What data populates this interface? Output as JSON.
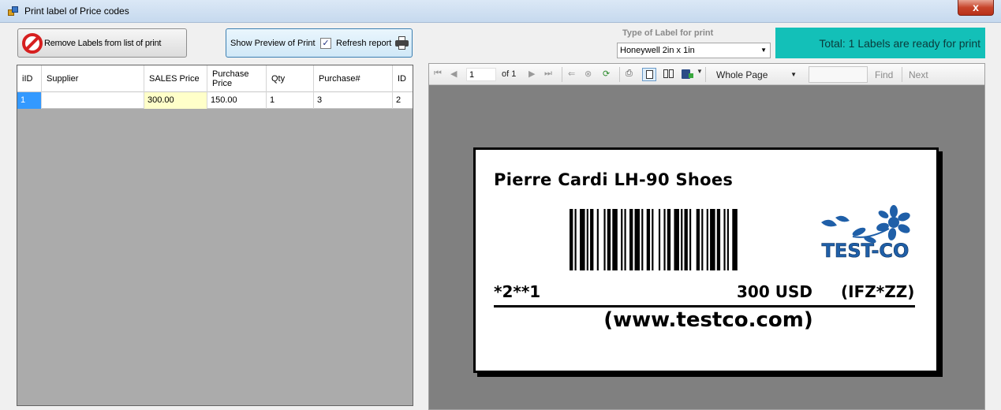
{
  "window": {
    "title": "Print label of Price codes",
    "close": "x"
  },
  "toolbar": {
    "remove_label": "Remove Labels from list of print",
    "preview_label": "Show Preview of Print",
    "refresh_checked": true,
    "refresh_check_glyph": "✓",
    "refresh_label": "Refresh report"
  },
  "label_type": {
    "heading": "Type of Label for print",
    "selected": "Honeywell 2in x 1in"
  },
  "total": {
    "text": "Total: 1 Labels are ready for print"
  },
  "grid": {
    "columns": [
      "iID",
      "Supplier",
      "SALES Price",
      "Purchase Price",
      "Qty",
      "Purchase#",
      "ID"
    ],
    "rows": [
      {
        "iID": "1",
        "Supplier": "",
        "SALES Price": "300.00",
        "Purchase Price": "150.00",
        "Qty": "1",
        "Purchase#": "3",
        "ID": "2"
      }
    ]
  },
  "viewer": {
    "page": "1",
    "of_label": "of  1",
    "zoom": "Whole Page",
    "find_label": "Find",
    "next_label": "Next"
  },
  "label": {
    "title": "Pierre Cardi LH-90  Shoes",
    "code_left": "*2**1",
    "price": "300 USD",
    "code_right": "(IFZ*ZZ)",
    "url": "(www.testco.com)",
    "logo_text": "TEST-CO",
    "logo_color": "#1f5fa8"
  }
}
